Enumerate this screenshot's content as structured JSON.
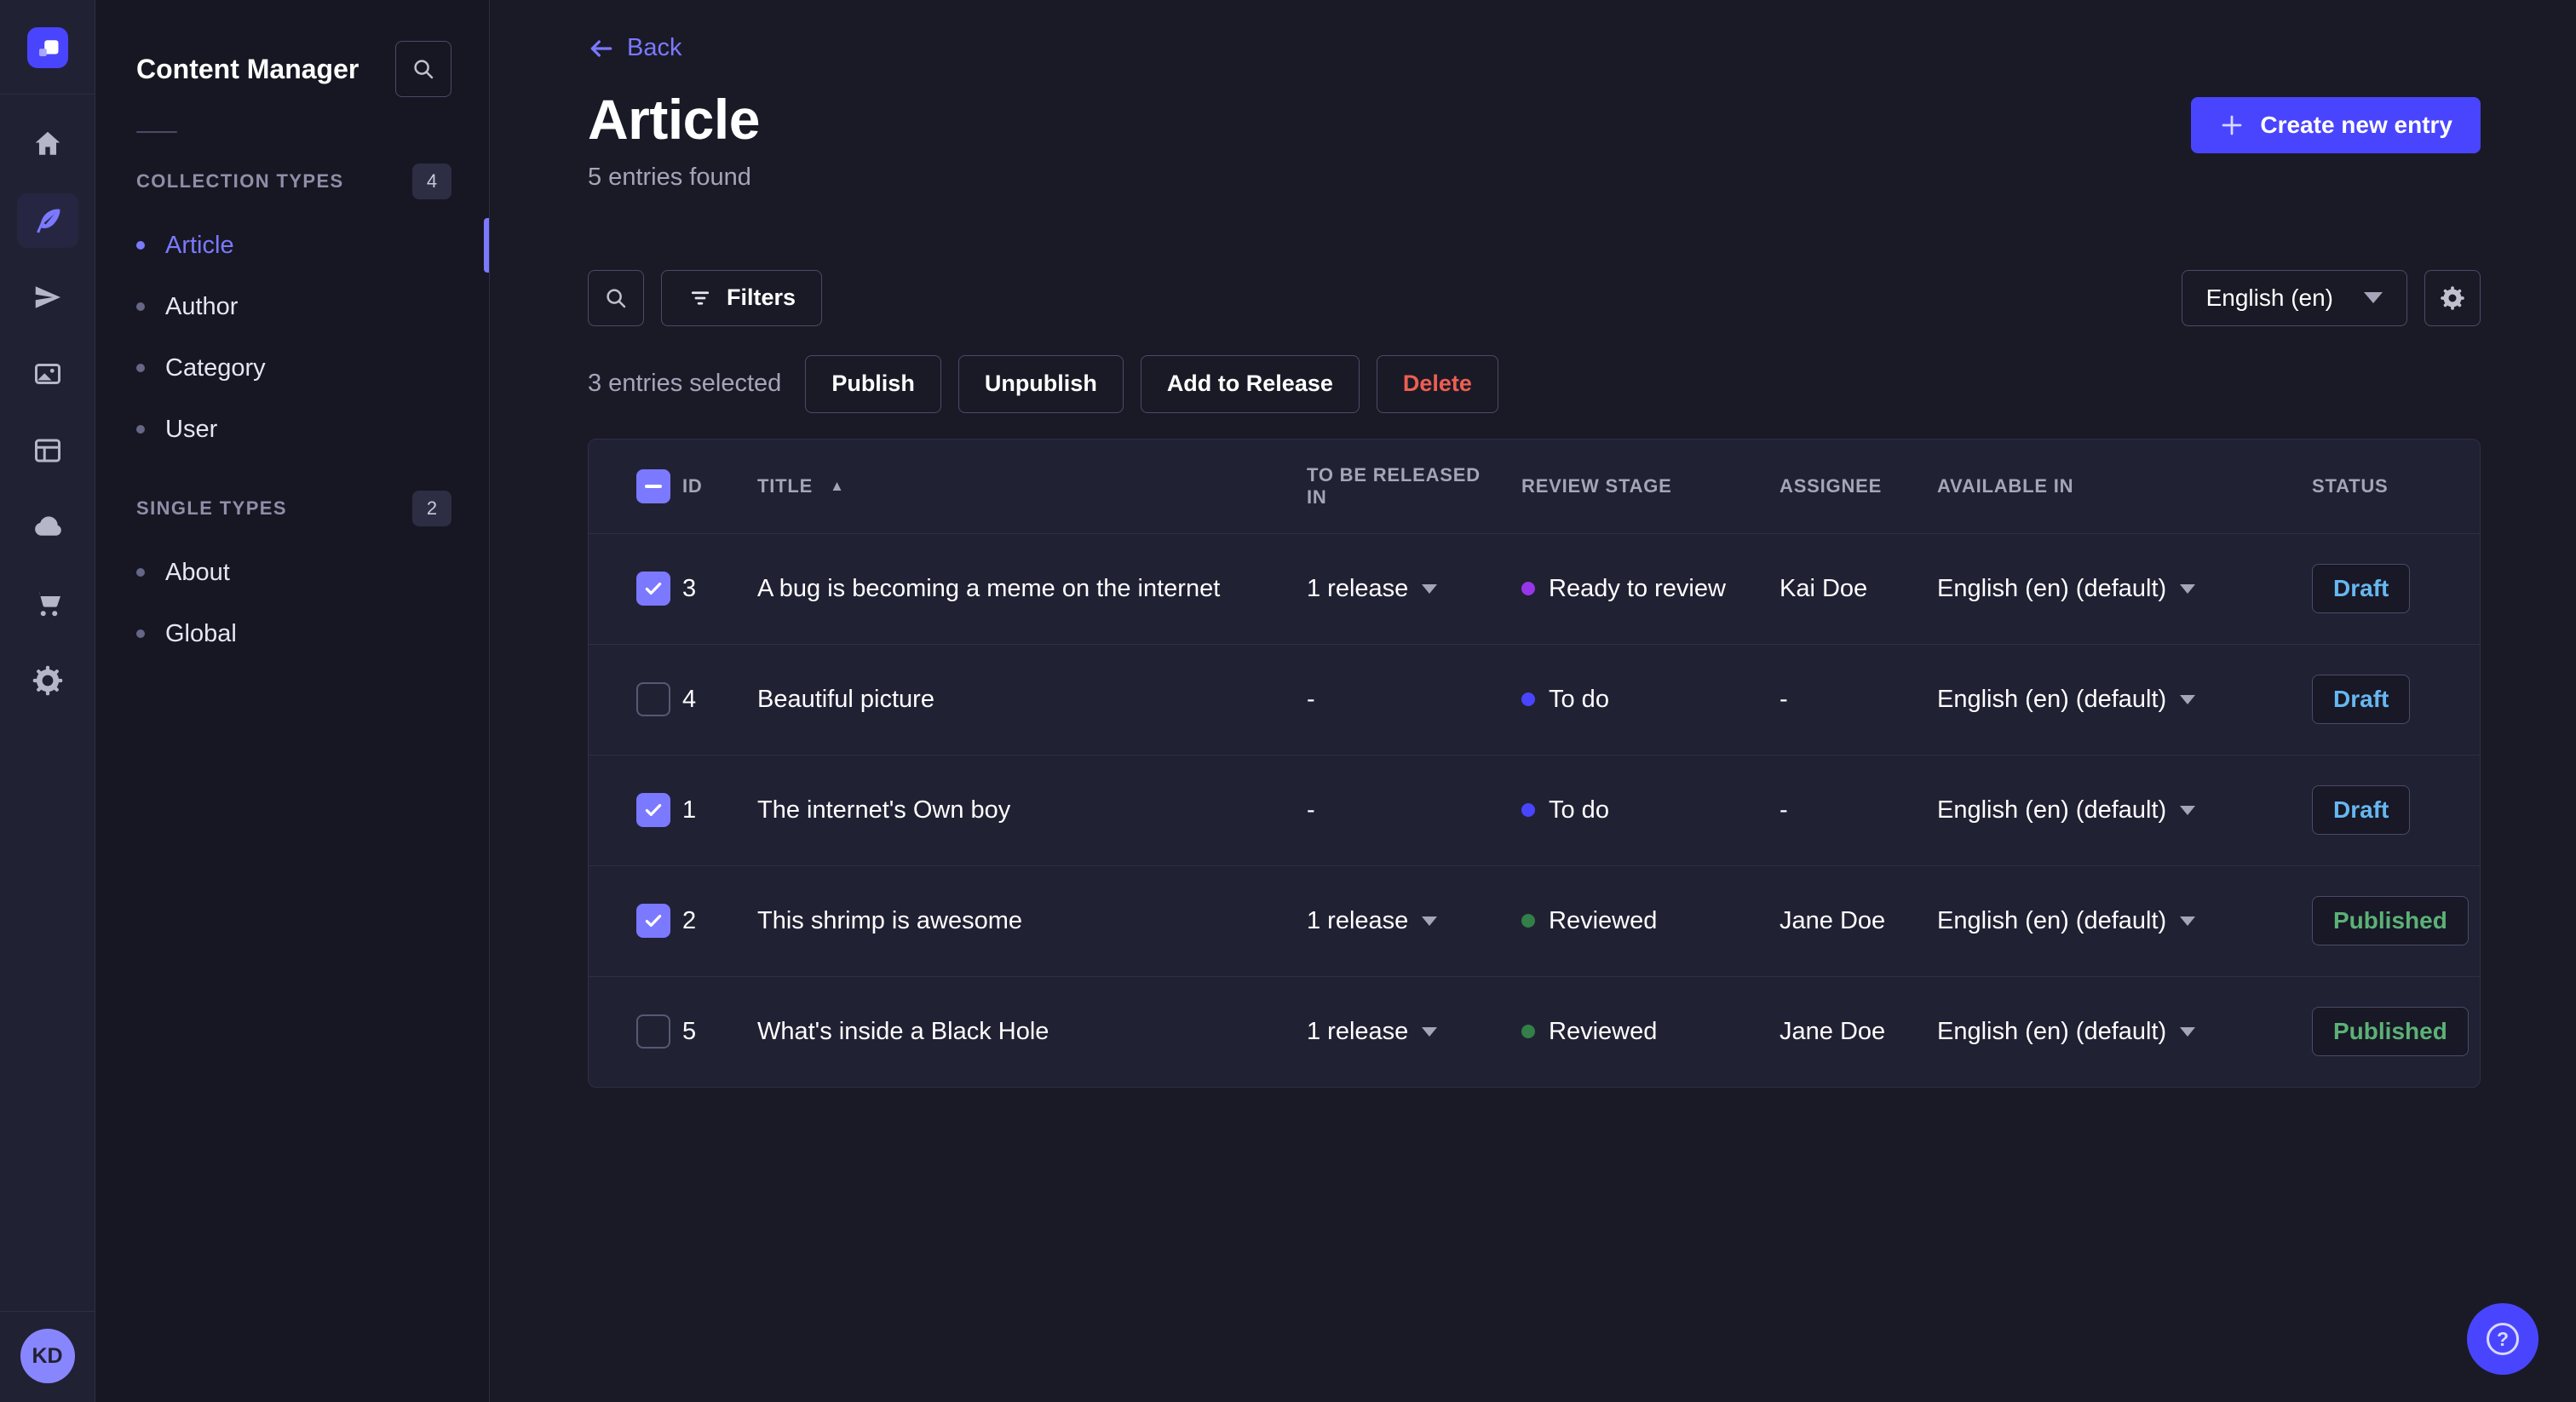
{
  "rail": {
    "avatar_initials": "KD",
    "icons": [
      "strapi-logo",
      "home",
      "content-manager",
      "releases",
      "media-library",
      "content-type-builder",
      "deploy",
      "marketplace",
      "settings"
    ]
  },
  "subnav": {
    "title": "Content Manager",
    "sections": [
      {
        "label": "COLLECTION TYPES",
        "badge": "4",
        "items": [
          {
            "label": "Article",
            "active": true
          },
          {
            "label": "Author",
            "active": false
          },
          {
            "label": "Category",
            "active": false
          },
          {
            "label": "User",
            "active": false
          }
        ]
      },
      {
        "label": "SINGLE TYPES",
        "badge": "2",
        "items": [
          {
            "label": "About",
            "active": false
          },
          {
            "label": "Global",
            "active": false
          }
        ]
      }
    ]
  },
  "header": {
    "back": "Back",
    "title": "Article",
    "subtitle": "5 entries found",
    "create_button": "Create new entry"
  },
  "toolbar": {
    "filters_label": "Filters",
    "locale": "English (en)"
  },
  "selection": {
    "text": "3 entries selected",
    "actions": [
      {
        "label": "Publish",
        "danger": false
      },
      {
        "label": "Unpublish",
        "danger": false
      },
      {
        "label": "Add to Release",
        "danger": false
      },
      {
        "label": "Delete",
        "danger": true
      }
    ]
  },
  "table": {
    "headers": {
      "id": "ID",
      "title": "TITLE",
      "released": "TO BE RELEASED IN",
      "stage": "REVIEW STAGE",
      "assignee": "ASSIGNEE",
      "available": "AVAILABLE IN",
      "status": "STATUS"
    },
    "rows": [
      {
        "selected": true,
        "id": "3",
        "title": "A bug is becoming a meme on the internet",
        "release": "1 release",
        "stage": "Ready to review",
        "stage_color": "#9736e8",
        "assignee": "Kai Doe",
        "locale": "English (en) (default)",
        "status": "Draft"
      },
      {
        "selected": false,
        "id": "4",
        "title": "Beautiful picture",
        "release": "-",
        "stage": "To do",
        "stage_color": "#4945ff",
        "assignee": "-",
        "locale": "English (en) (default)",
        "status": "Draft"
      },
      {
        "selected": true,
        "id": "1",
        "title": "The internet's Own boy",
        "release": "-",
        "stage": "To do",
        "stage_color": "#4945ff",
        "assignee": "-",
        "locale": "English (en) (default)",
        "status": "Draft"
      },
      {
        "selected": true,
        "id": "2",
        "title": "This shrimp is awesome",
        "release": "1 release",
        "stage": "Reviewed",
        "stage_color": "#328048",
        "assignee": "Jane Doe",
        "locale": "English (en) (default)",
        "status": "Published"
      },
      {
        "selected": false,
        "id": "5",
        "title": "What's inside a Black Hole",
        "release": "1 release",
        "stage": "Reviewed",
        "stage_color": "#328048",
        "assignee": "Jane Doe",
        "locale": "English (en) (default)",
        "status": "Published"
      }
    ]
  },
  "colors": {
    "accent_primary": "#4945ff",
    "accent_light": "#7b79ff",
    "danger": "#ee5e52",
    "status_draft": "#66b7f1",
    "status_published": "#5cb176"
  }
}
